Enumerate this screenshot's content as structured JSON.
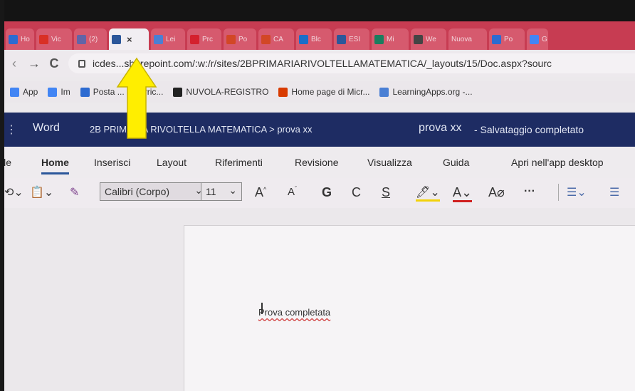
{
  "browser": {
    "tabs": [
      {
        "label": "Ho",
        "icon": "outlook-icon",
        "color": "#2d6bd1"
      },
      {
        "label": "Vic",
        "icon": "youtube-icon",
        "color": "#d93025"
      },
      {
        "label": "(2)",
        "icon": "teams-icon",
        "color": "#6264a7"
      },
      {
        "label": "",
        "icon": "word-icon",
        "color": "#2b579a",
        "active": true,
        "close": "×"
      },
      {
        "label": "Lei",
        "icon": "learningapps-icon",
        "color": "#4a7fd4"
      },
      {
        "label": "Prc",
        "icon": "pinterest-icon",
        "color": "#d4212e"
      },
      {
        "label": "Po",
        "icon": "powerpoint-icon",
        "color": "#d24726"
      },
      {
        "label": "CA",
        "icon": "powerpoint-icon",
        "color": "#d24726"
      },
      {
        "label": "Blc",
        "icon": "onedrive-icon",
        "color": "#1a6ec9"
      },
      {
        "label": "ESI",
        "icon": "word-icon",
        "color": "#2b579a"
      },
      {
        "label": "Mi",
        "icon": "forms-icon",
        "color": "#1b7d5e"
      },
      {
        "label": "We",
        "icon": "we-icon",
        "color": "#444"
      },
      {
        "label": "Nuova",
        "icon": "",
        "color": "#d65a6e"
      },
      {
        "label": "Po",
        "icon": "outlook-icon",
        "color": "#2d6bd1"
      },
      {
        "label": "G",
        "icon": "google-icon",
        "color": "#4285f4"
      }
    ],
    "url": "icdes...sharepoint.com/:w:/r/sites/2BPRIMARIARIVOLTELLAMATEMATICA/_layouts/15/Doc.aspx?sourc",
    "bookmarks": [
      {
        "label": "App",
        "icon": "apps-icon"
      },
      {
        "label": "Im",
        "icon": "google-icon"
      },
      {
        "label": "Posta ... na Erric...",
        "icon": "outlook-icon"
      },
      {
        "label": "NUVOLA-REGISTRO",
        "icon": "cloud-icon"
      },
      {
        "label": "Home page di Micr...",
        "icon": "office-icon"
      },
      {
        "label": "LearningApps.org -...",
        "icon": "learningapps-icon"
      }
    ]
  },
  "word": {
    "app_name": "Word",
    "breadcrumb": "2B PRIMARIA RIVOLTELLA MATEMATICA > prova xx",
    "doc_name": "prova xx",
    "status": "-   Salvataggio completato",
    "ribbon_tabs": [
      "ile",
      "Home",
      "Inserisci",
      "Layout",
      "Riferimenti",
      "Revisione",
      "Visualizza",
      "Guida",
      "Apri nell'app desktop"
    ],
    "font_name": "Calibri (Corpo)",
    "font_size": "11",
    "toolbar_glyphs": {
      "grow": "A",
      "shrink": "A",
      "bold": "G",
      "italic": "C",
      "underline": "S",
      "more": "···"
    },
    "document_text": "Prova completata"
  },
  "colors": {
    "tabstrip": "#c73c52",
    "word_header": "#1e2c63",
    "annotation_arrow": "#ffee00"
  }
}
